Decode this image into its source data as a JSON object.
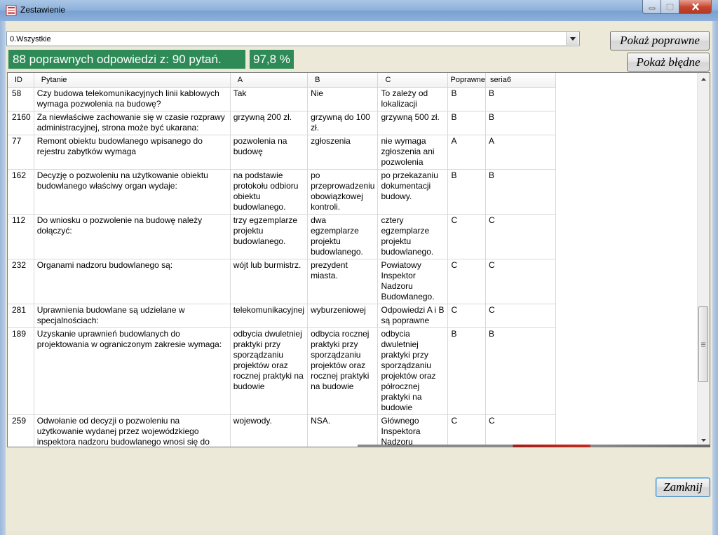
{
  "window": {
    "title": "Zestawienie"
  },
  "filter": {
    "selected": "0.Wszystkie"
  },
  "buttons": {
    "show_correct": "Pokaż poprawne",
    "show_wrong": "Pokaż błędne",
    "close": "Zamknij"
  },
  "summary": {
    "text": "88 poprawnych odpowiedzi z: 90 pytań.",
    "percent": "97,8 %"
  },
  "colors": {
    "status_bg": "#2e8b57",
    "titlebar": "#8fb2dc",
    "close_btn": "#c5442e"
  },
  "table": {
    "headers": {
      "id": "ID",
      "question": "Pytanie",
      "a": "A",
      "b": "B",
      "c": "C",
      "correct": "Poprawne",
      "series": "seria6"
    },
    "rows": [
      {
        "id": "58",
        "question": "Czy budowa telekomunikacyjnych linii kablowych wymaga pozwolenia na budowę?",
        "a": "Tak",
        "b": "Nie",
        "c": "To zależy od lokalizacji",
        "correct": "B",
        "series": "B"
      },
      {
        "id": "2160",
        "question": "Za niewłaściwe zachowanie się w czasie rozprawy administracyjnej, strona może być ukarana:",
        "a": "grzywną 200 zł.",
        "b": "grzywną do 100 zł.",
        "c": "grzywną 500 zł.",
        "correct": "B",
        "series": "B"
      },
      {
        "id": "77",
        "question": "Remont obiektu budowlanego wpisanego do rejestru zabytków wymaga",
        "a": "pozwolenia na budowę",
        "b": "zgłoszenia",
        "c": "nie wymaga zgłoszenia ani pozwolenia",
        "correct": "A",
        "series": "A"
      },
      {
        "id": "162",
        "question": "Decyzję o pozwoleniu na użytkowanie obiektu budowlanego właściwy organ wydaje:",
        "a": "na podstawie protokołu odbioru obiektu budowlanego.",
        "b": "po przeprowadzeniu obowiązkowej kontroli.",
        "c": "po przekazaniu dokumentacji budowy.",
        "correct": "B",
        "series": "B"
      },
      {
        "id": "112",
        "question": "Do wniosku o pozwolenie na budowę należy dołączyć:",
        "a": "trzy egzemplarze projektu budowlanego.",
        "b": "dwa egzemplarze projektu budowlanego.",
        "c": "cztery egzemplarze projektu budowlanego.",
        "correct": "C",
        "series": "C"
      },
      {
        "id": "232",
        "question": "Organami nadzoru budowlanego są:",
        "a": "wójt lub burmistrz.",
        "b": "prezydent miasta.",
        "c": "Powiatowy Inspektor Nadzoru Budowlanego.",
        "correct": "C",
        "series": "C"
      },
      {
        "id": "281",
        "question": "Uprawnienia budowlane są udzielane w specjalnościach:",
        "a": "telekomunikacyjnej",
        "b": "wyburzeniowej",
        "c": "Odpowiedzi A i B są poprawne",
        "correct": "C",
        "series": "C"
      },
      {
        "id": "189",
        "question": "Uzyskanie uprawnień budowlanych do projektowania w ograniczonym zakresie wymaga:",
        "a": "odbycia dwuletniej praktyki przy sporządzaniu projektów oraz rocznej praktyki na budowie",
        "b": "odbycia rocznej praktyki przy sporządzaniu projektów oraz rocznej praktyki na budowie",
        "c": "odbycia dwuletniej praktyki przy sporządzaniu projektów oraz półrocznej praktyki na budowie",
        "correct": "B",
        "series": "B"
      },
      {
        "id": "259",
        "question": "Odwołanie od decyzji o pozwoleniu na użytkowanie wydanej przez wojewódzkiego inspektora nadzoru budowlanego wnosi się do",
        "a": "wojewody.",
        "b": "NSA.",
        "c": "Głównego Inspektora Nadzoru Budowlanego.",
        "correct": "C",
        "series": "C"
      }
    ]
  }
}
